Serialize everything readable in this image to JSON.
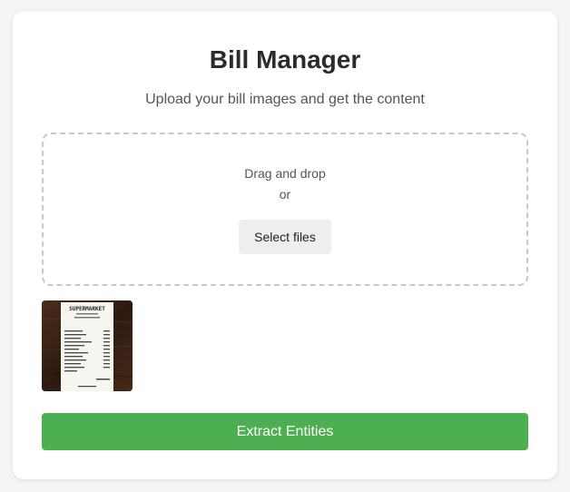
{
  "header": {
    "title": "Bill Manager",
    "subtitle": "Upload your bill images and get the content"
  },
  "dropzone": {
    "drag_text": "Drag and drop",
    "or_text": "or",
    "select_label": "Select files"
  },
  "uploads": [
    {
      "receipt_heading": "SUPERMARKET"
    }
  ],
  "actions": {
    "extract_label": "Extract Entities"
  },
  "colors": {
    "primary": "#4caf50",
    "background": "#f4f4f4"
  }
}
